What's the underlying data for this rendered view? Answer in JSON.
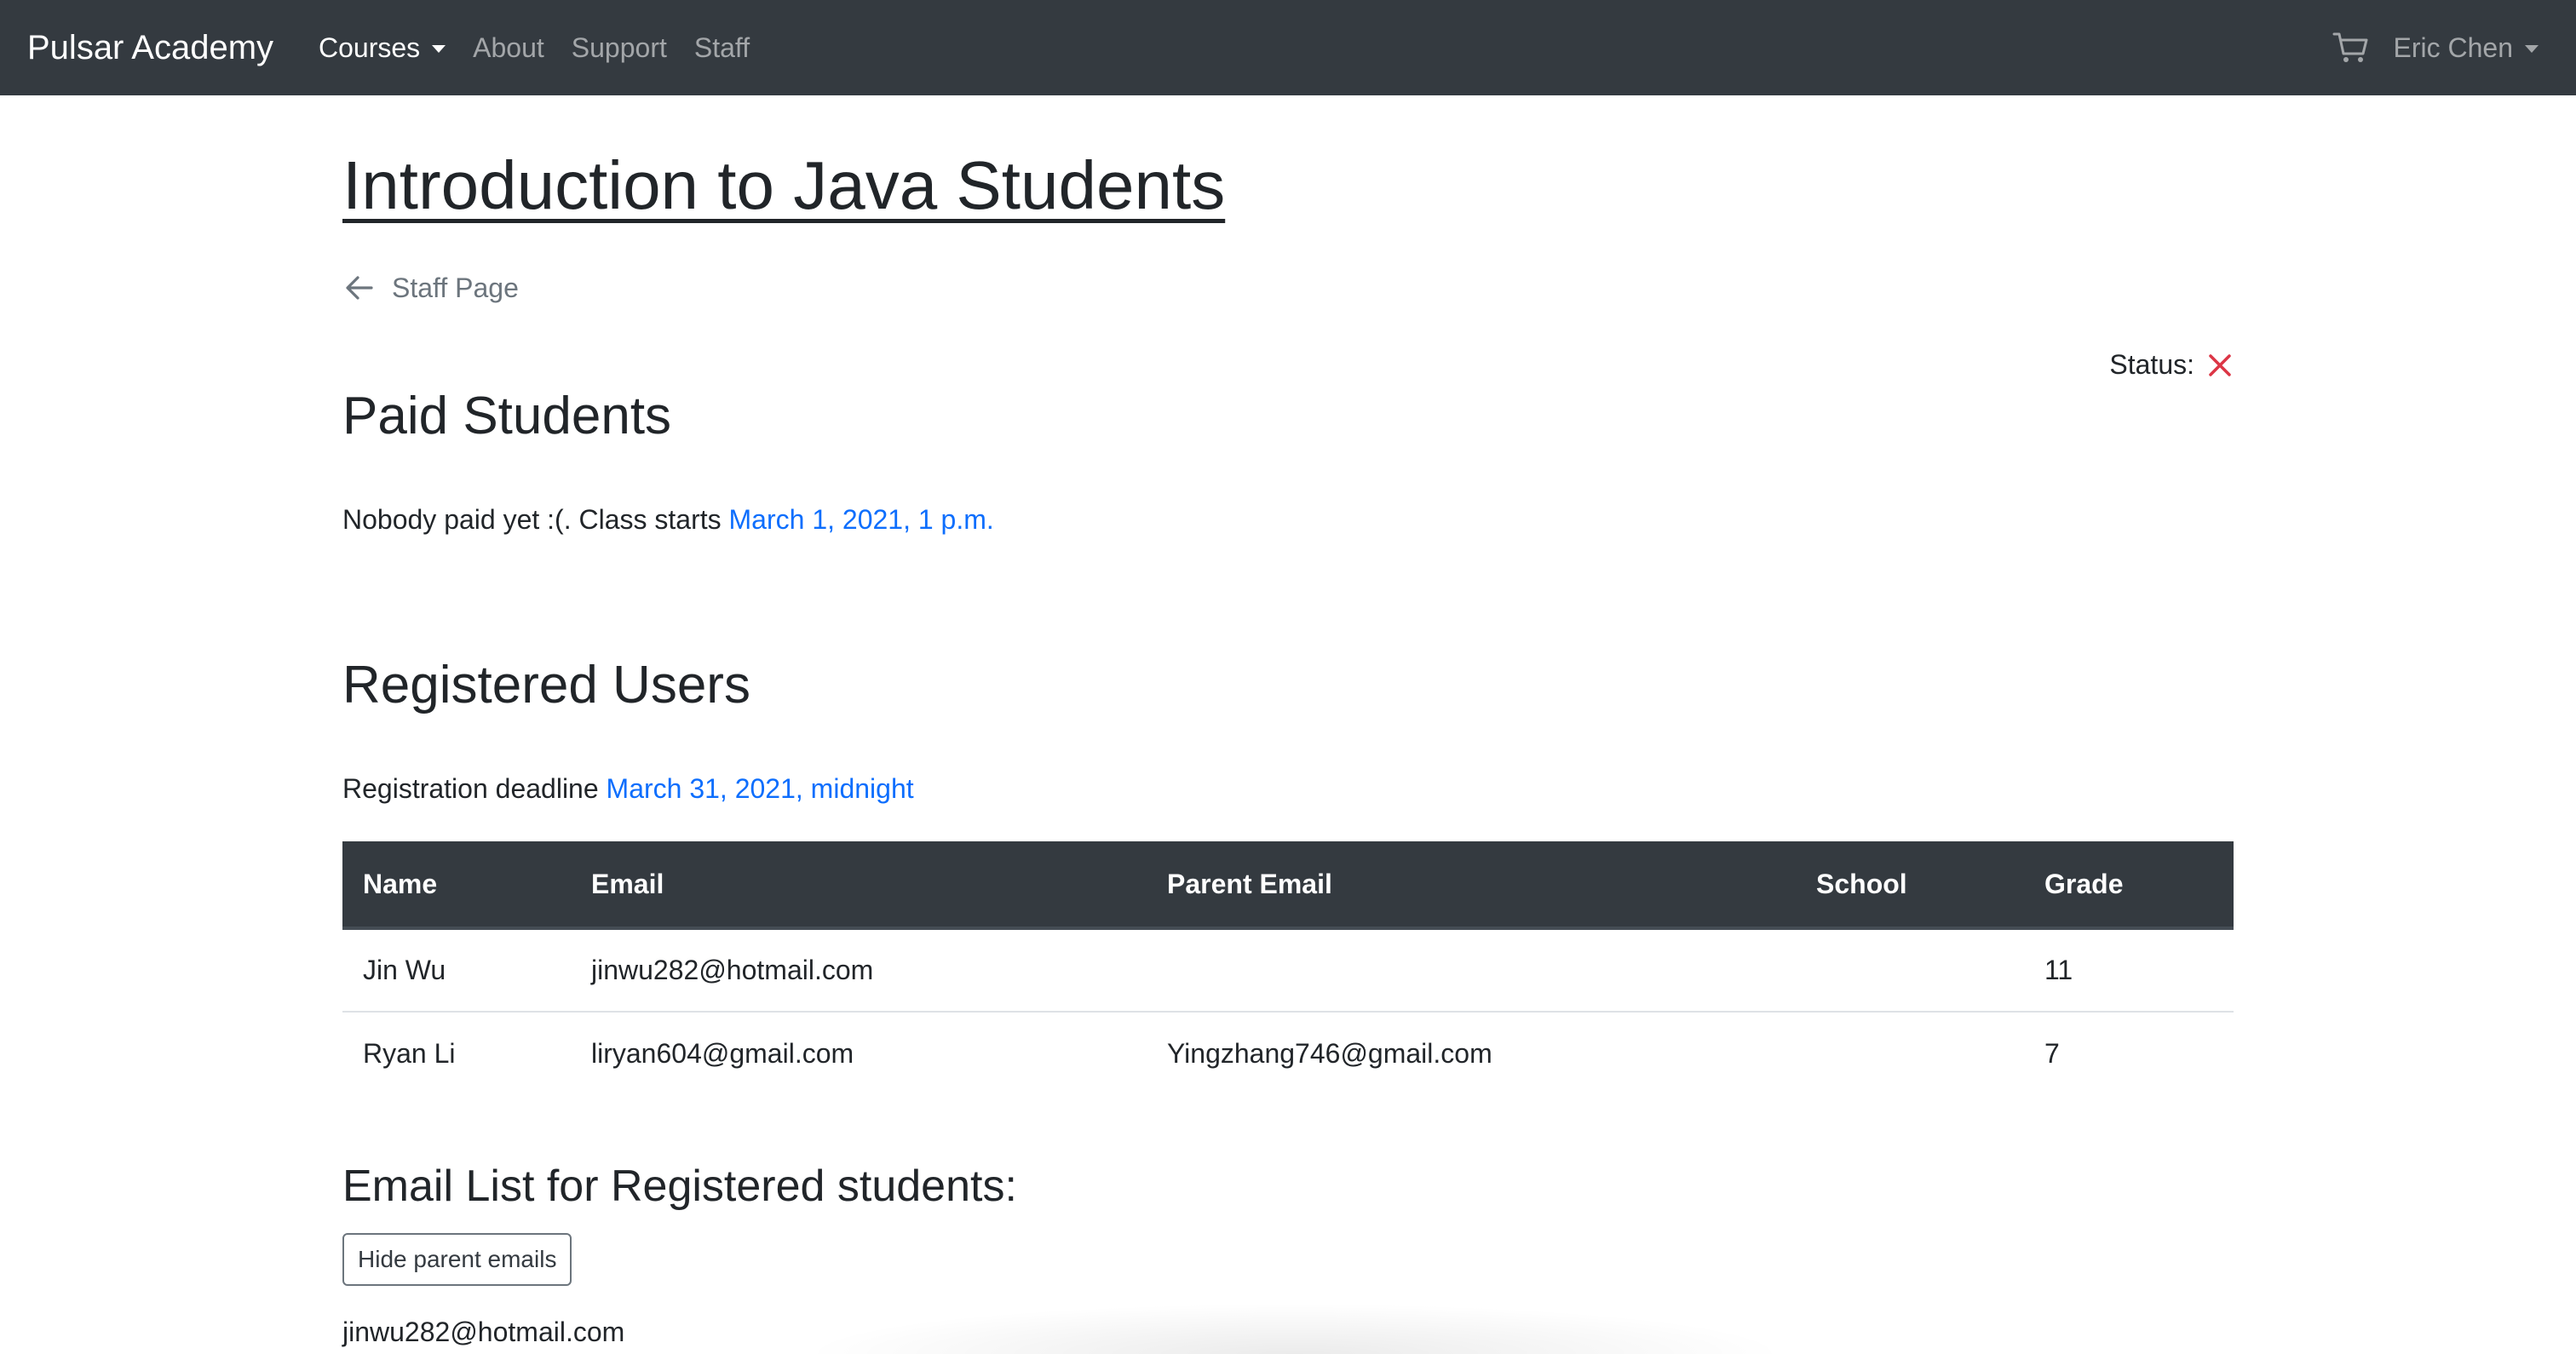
{
  "navbar": {
    "brand": "Pulsar Academy",
    "links": [
      {
        "label": "Courses",
        "active": true,
        "dropdown": true
      },
      {
        "label": "About"
      },
      {
        "label": "Support"
      },
      {
        "label": "Staff"
      }
    ],
    "cart_icon": "cart-icon",
    "user": "Eric Chen"
  },
  "page": {
    "title": "Introduction to Java Students",
    "back_label": "Staff Page",
    "status_label": "Status:",
    "status_icon": "close-icon",
    "status_color": "#dc3545"
  },
  "paid": {
    "heading": "Paid Students",
    "text": "Nobody paid yet :(. Class starts ",
    "date": "March 1, 2021, 1 p.m."
  },
  "registered": {
    "heading": "Registered Users",
    "text": "Registration deadline ",
    "deadline": "March 31, 2021, midnight",
    "columns": [
      "Name",
      "Email",
      "Parent Email",
      "School",
      "Grade"
    ],
    "rows": [
      [
        "Jin Wu",
        "jinwu282@hotmail.com",
        "",
        "",
        "11"
      ],
      [
        "Ryan Li",
        "liryan604@gmail.com",
        "Yingzhang746@gmail.com",
        "",
        "7"
      ]
    ]
  },
  "email_list": {
    "heading": "Email List for Registered students:",
    "button_label": "Hide parent emails",
    "first_email": "jinwu282@hotmail.com"
  },
  "colors": {
    "navbar_bg": "#343a40",
    "link": "#0d6efd",
    "status_x": "#dc3545"
  }
}
